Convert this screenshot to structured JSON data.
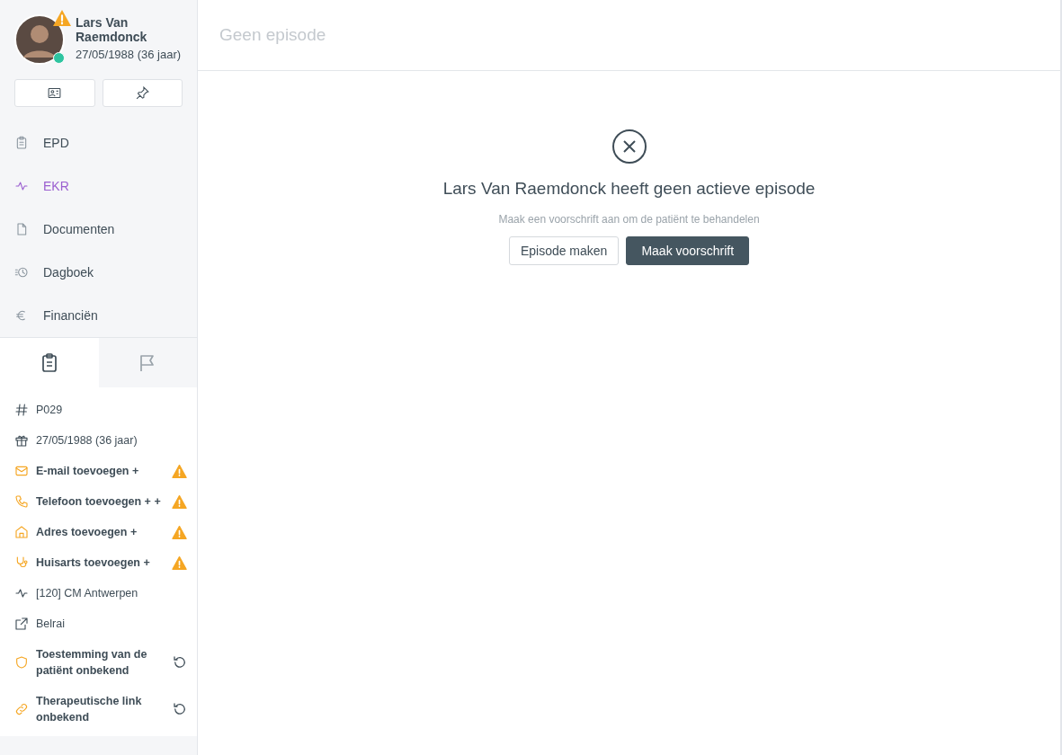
{
  "patient": {
    "name": "Lars Van Raemdonck",
    "birth": "27/05/1988 (36 jaar)",
    "warning": true,
    "online": true
  },
  "quick_buttons": [
    {
      "kind": "card"
    },
    {
      "kind": "pin"
    }
  ],
  "nav": [
    {
      "kind": "clipboard",
      "label": "EPD",
      "selected": false
    },
    {
      "kind": "pulse",
      "label": "EKR",
      "selected": true
    },
    {
      "kind": "file",
      "label": "Documenten",
      "selected": false
    },
    {
      "kind": "history",
      "label": "Dagboek",
      "selected": false
    },
    {
      "kind": "euro",
      "label": "Financiën",
      "selected": false
    }
  ],
  "tabs": [
    {
      "kind": "clipboard",
      "selected": true
    },
    {
      "kind": "flag",
      "selected": false
    }
  ],
  "info": [
    {
      "kind": "hash",
      "label": "P029",
      "highlighted": false,
      "warning": false,
      "refresh": false
    },
    {
      "kind": "gift",
      "label": "27/05/1988 (36 jaar)",
      "highlighted": false,
      "warning": false,
      "refresh": false
    },
    {
      "kind": "mail",
      "label": "E-mail toevoegen +",
      "highlighted": true,
      "warning": true,
      "refresh": false
    },
    {
      "kind": "phone",
      "label": "Telefoon toevoegen + +",
      "highlighted": true,
      "warning": true,
      "refresh": false
    },
    {
      "kind": "home",
      "label": "Adres toevoegen +",
      "highlighted": true,
      "warning": true,
      "refresh": false
    },
    {
      "kind": "stethoscope",
      "label": "Huisarts toevoegen +",
      "highlighted": true,
      "warning": true,
      "refresh": false
    },
    {
      "kind": "pulse",
      "label": "[120] CM Antwerpen",
      "highlighted": false,
      "warning": false,
      "refresh": false
    },
    {
      "kind": "external",
      "label": "Belrai",
      "highlighted": false,
      "warning": false,
      "refresh": false
    },
    {
      "kind": "shield",
      "label": "Toestemming van de patiënt onbekend",
      "highlighted": true,
      "warning": false,
      "refresh": true
    },
    {
      "kind": "link",
      "label": "Therapeutische link onbekend",
      "highlighted": true,
      "warning": false,
      "refresh": true
    }
  ],
  "header": {
    "title": "Geen episode"
  },
  "empty_state": {
    "title": "Lars Van Raemdonck heeft geen actieve episode",
    "subtitle": "Maak een voorschrift aan om de patiënt te behandelen",
    "buttons": [
      {
        "label": "Episode maken",
        "kind": "secondary"
      },
      {
        "label": "Maak voorschrift",
        "kind": "primary"
      }
    ]
  }
}
